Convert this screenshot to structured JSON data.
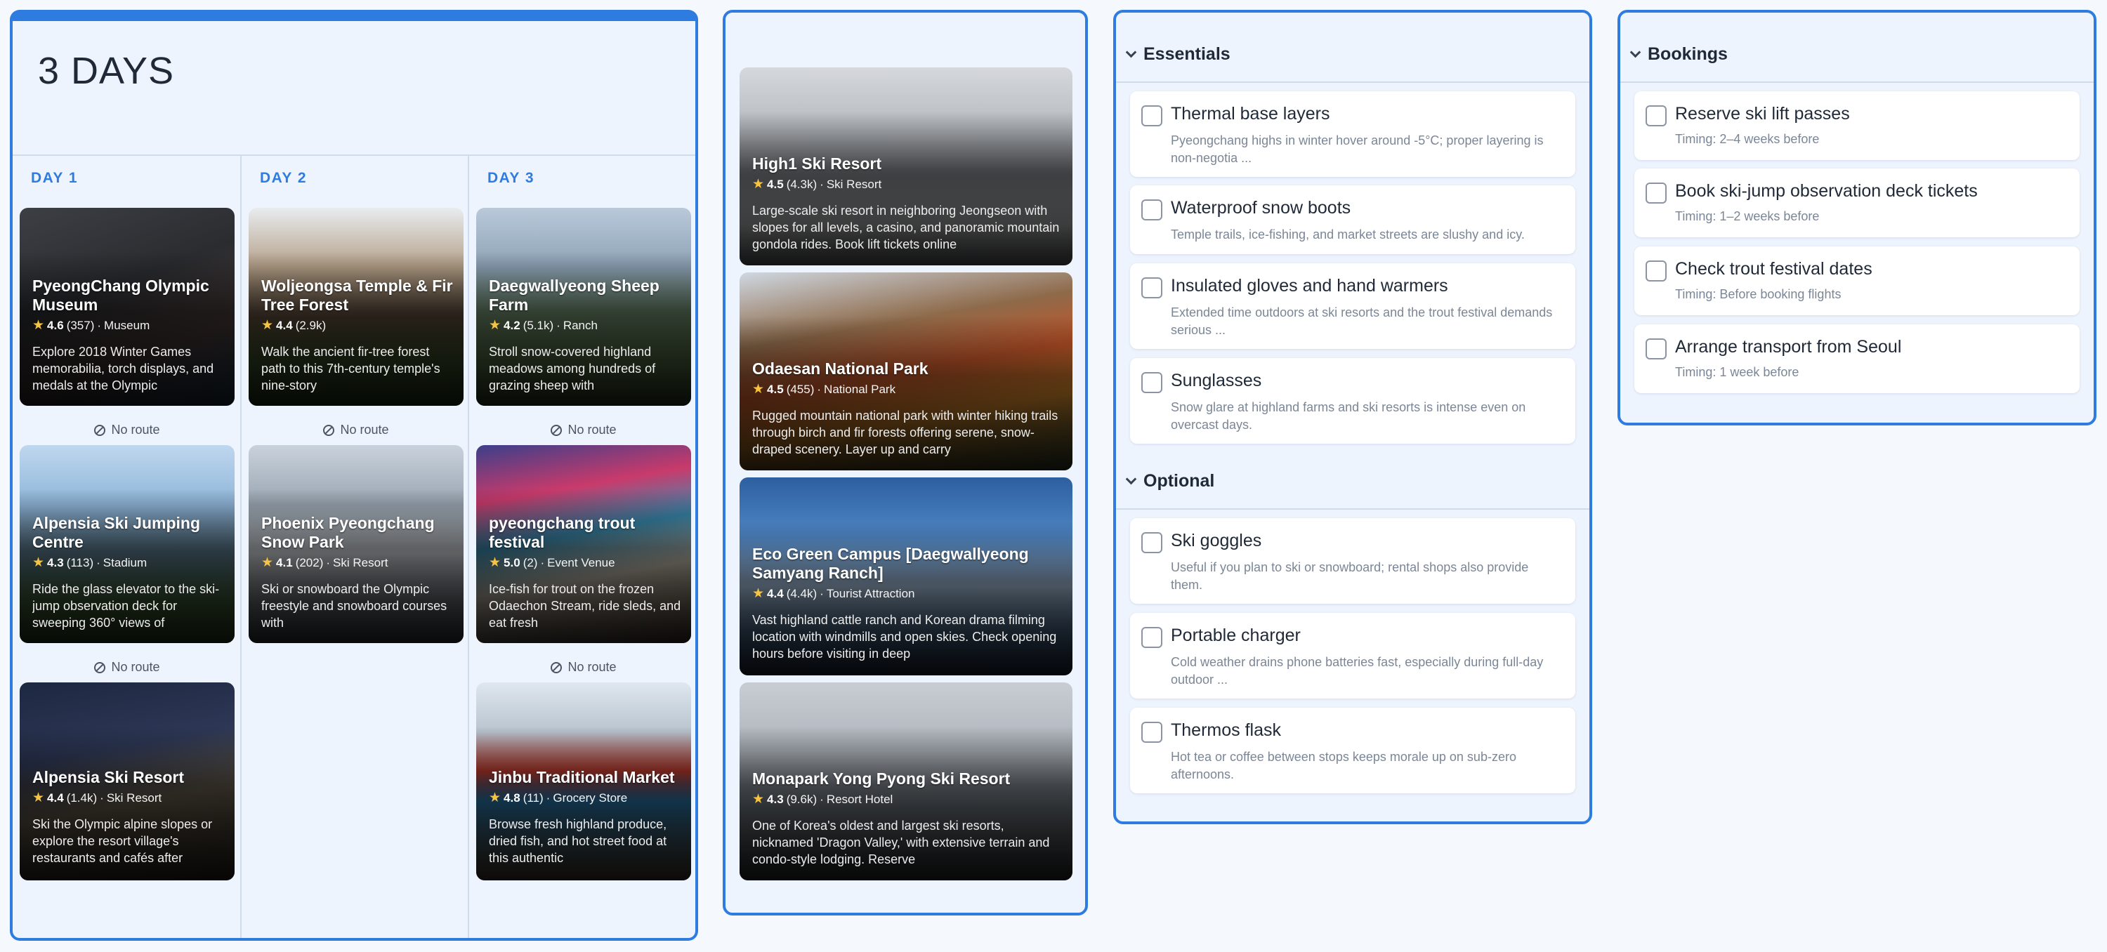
{
  "itinerary": {
    "title": "3 DAYS",
    "no_route_label": "No route",
    "days": [
      {
        "label": "DAY 1",
        "places": [
          {
            "name": "PyeongChang Olympic Museum",
            "rating": "4.6",
            "reviews": "(357)",
            "category": "Museum",
            "description": "Explore 2018 Winter Games memorabilia, torch displays, and medals at the Olympic"
          },
          {
            "name": "Alpensia Ski Jumping Centre",
            "rating": "4.3",
            "reviews": "(113)",
            "category": "Stadium",
            "description": "Ride the glass elevator to the ski-jump observation deck for sweeping 360° views of"
          },
          {
            "name": "Alpensia Ski Resort",
            "rating": "4.4",
            "reviews": "(1.4k)",
            "category": "Ski Resort",
            "description": "Ski the Olympic alpine slopes or explore the resort village's restaurants and cafés after"
          }
        ]
      },
      {
        "label": "DAY 2",
        "places": [
          {
            "name": "Woljeongsa Temple & Fir Tree Forest",
            "rating": "4.4",
            "reviews": "(2.9k)",
            "category": "",
            "description": "Walk the ancient fir-tree forest path to this 7th-century temple's nine-story"
          },
          {
            "name": "Phoenix Pyeongchang Snow Park",
            "rating": "4.1",
            "reviews": "(202)",
            "category": "Ski Resort",
            "description": "Ski or snowboard the Olympic freestyle and snowboard courses with"
          }
        ]
      },
      {
        "label": "DAY 3",
        "places": [
          {
            "name": "Daegwallyeong Sheep Farm",
            "rating": "4.2",
            "reviews": "(5.1k)",
            "category": "Ranch",
            "description": "Stroll snow-covered highland meadows among hundreds of grazing sheep with"
          },
          {
            "name": "pyeongchang trout festival",
            "rating": "5.0",
            "reviews": "(2)",
            "category": "Event Venue",
            "description": "Ice-fish for trout on the frozen Odaechon Stream, ride sleds, and eat fresh"
          },
          {
            "name": "Jinbu Traditional Market",
            "rating": "4.8",
            "reviews": "(11)",
            "category": "Grocery Store",
            "description": "Browse fresh highland produce, dried fish, and hot street food at this authentic"
          }
        ]
      }
    ]
  },
  "featured": [
    {
      "name": "High1 Ski Resort",
      "rating": "4.5",
      "reviews": "(4.3k)",
      "category": "Ski Resort",
      "description": "Large-scale ski resort in neighboring Jeongseon with slopes for all levels, a casino, and panoramic mountain gondola rides. Book lift tickets online"
    },
    {
      "name": "Odaesan National Park",
      "rating": "4.5",
      "reviews": "(455)",
      "category": "National Park",
      "description": "Rugged mountain national park with winter hiking trails through birch and fir forests offering serene, snow-draped scenery. Layer up and carry"
    },
    {
      "name": "Eco Green Campus [Daegwallyeong Samyang Ranch]",
      "rating": "4.4",
      "reviews": "(4.4k)",
      "category": "Tourist Attraction",
      "description": "Vast highland cattle ranch and Korean drama filming location with windmills and open skies. Check opening hours before visiting in deep"
    },
    {
      "name": "Monapark Yong Pyong Ski Resort",
      "rating": "4.3",
      "reviews": "(9.6k)",
      "category": "Resort Hotel",
      "description": "One of Korea's oldest and largest ski resorts, nicknamed 'Dragon Valley,' with extensive terrain and condo-style lodging. Reserve"
    }
  ],
  "packing": {
    "essentials": {
      "title": "Essentials",
      "items": [
        {
          "title": "Thermal base layers",
          "desc": "Pyeongchang highs in winter hover around -5°C; proper layering is non-negotia  ..."
        },
        {
          "title": "Waterproof snow boots",
          "desc": "Temple trails, ice-fishing, and market streets are slushy and icy."
        },
        {
          "title": "Insulated gloves and hand warmers",
          "desc": "Extended time outdoors at ski resorts and the trout festival demands serious  ..."
        },
        {
          "title": "Sunglasses",
          "desc": "Snow glare at highland farms and ski resorts is intense even on overcast days."
        }
      ]
    },
    "optional": {
      "title": "Optional",
      "items": [
        {
          "title": "Ski goggles",
          "desc": "Useful if you plan to ski or snowboard; rental shops also provide them."
        },
        {
          "title": "Portable charger",
          "desc": "Cold weather drains phone batteries fast, especially during full-day outdoor  ..."
        },
        {
          "title": "Thermos flask",
          "desc": "Hot tea or coffee between stops keeps morale up on sub-zero afternoons."
        }
      ]
    }
  },
  "bookings": {
    "title": "Bookings",
    "items": [
      {
        "title": "Reserve ski lift passes",
        "timing": "Timing: 2–4 weeks before"
      },
      {
        "title": "Book ski-jump observation deck tickets",
        "timing": "Timing: 1–2 weeks before"
      },
      {
        "title": "Check trout festival dates",
        "timing": "Timing: Before booking flights"
      },
      {
        "title": "Arrange transport from Seoul",
        "timing": "Timing: 1 week before"
      }
    ]
  }
}
